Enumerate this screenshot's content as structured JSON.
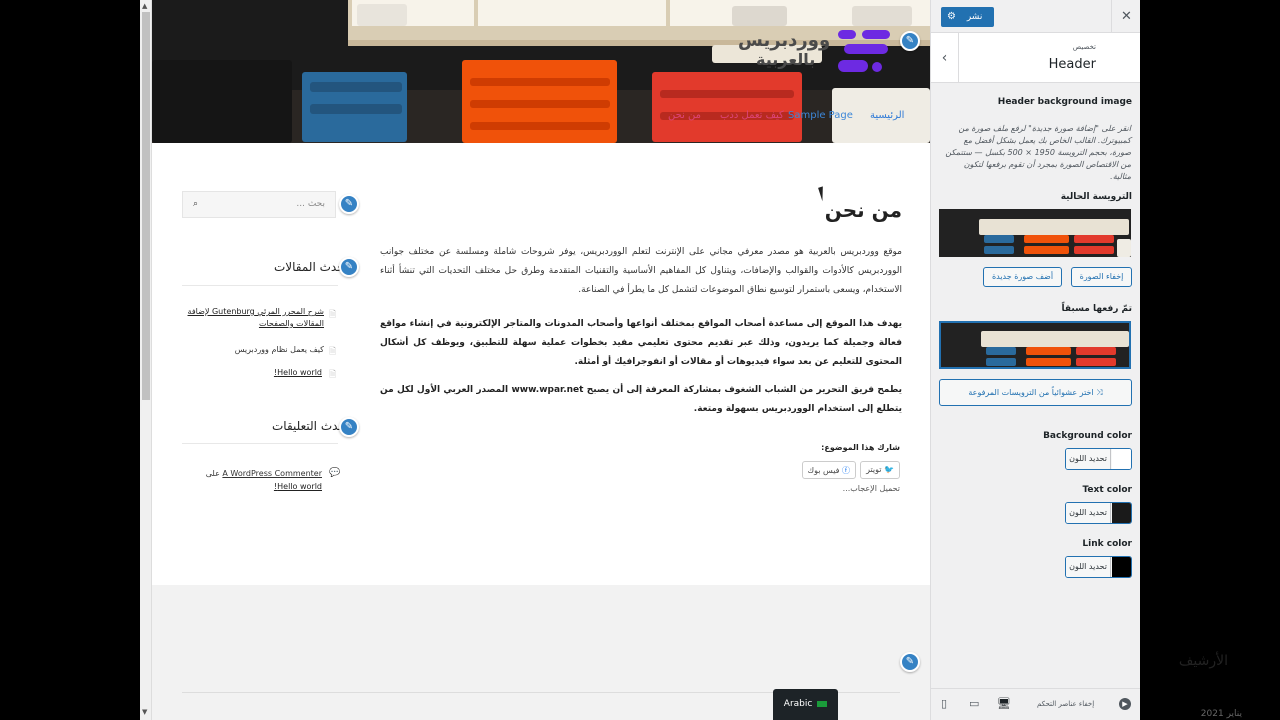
{
  "site": {
    "logo_text_line1": "ووردبريس",
    "logo_text_line2": "بالعربية",
    "nav": [
      "الرئيسية",
      "Sample Page",
      "كيف تعمل ددب",
      "من نحن"
    ]
  },
  "article": {
    "title": "من نحن",
    "paragraph1": "موقع ووردبريس بالعربية هو مصدر معرفي مجاني على الإنترنت لتعلم الووردبريس، يوفر شروحات شاملة ومسلسة عن مختلف جوانب الووردبريس كالأدوات والقوالب والإضافات، ويتناول كل المفاهيم الأساسية والتقنيات المتقدمة وطرق حل مختلف التحديات التي تنشأ أثناء الاستخدام، ويسعى باستمرار لتوسيع نطاق الموضوعات لتشمل كل ما يطرأ في الصناعة.",
    "paragraph2": "يهدف هذا الموقع إلى مساعدة أصحاب المواقع بمختلف أنواعها وأصحاب المدونات والمتاجر الإلكترونية في إنشاء مواقع فعالة وجميلة كما يريدون، وذلك عبر تقديم محتوى تعليمي مفيد بخطوات عملية سهلة للتطبيق، ويوظف كل أشكال المحتوى للتعليم عن بعد سواء فيديوهات أو مقالات أو انفوجرافيك أو أمثلة.",
    "paragraph3": "يطمح فريق التحرير من الشباب الشغوف بمشاركة المعرفة إلى أن يصبح www.wpar.net المصدر العربي الأول لكل من يتطلع إلى استخدام الووردبريس بسهولة ومتعة.",
    "share_label": "شارك هذا الموضوع:",
    "share_buttons": [
      "تويتر",
      "فيس بوك"
    ],
    "like_label": "تحميل الإعجاب..."
  },
  "sidebar": {
    "search_placeholder": "بحث ...",
    "recent_posts_title": "أحدث المقالات",
    "recent_posts": [
      "شرح المحرر المرئي Gutenburg لإضافة المقالات والصفحات",
      "كيف يعمل نظام ووردبريس",
      "Hello world!"
    ],
    "recent_comments_title": "أحدث التعليقات",
    "recent_comment_author": "A WordPress Commenter",
    "recent_comment_on": "على",
    "recent_comment_post": "Hello world!"
  },
  "archive": {
    "title": "الأرشيف",
    "date": "يناير 2021"
  },
  "language_switcher": {
    "label": "Arabic"
  },
  "customizer": {
    "publish_label": "نشر",
    "close_icon": "close-icon",
    "section_subtitle": "تخصيص",
    "section_title": "Header",
    "header_bg_label": "Header background image",
    "header_bg_desc": "انقر على \"إضافة صورة جديدة\" لرفع ملف صورة من كمبيوترك. القالب الخاص بك يعمل بشكل أفضل مع صورة، بحجم الترويسة 1950 × 500 بكسل — ستتمكن من الاقتصاص الصورة بمجرد أن تقوم برفعها لتكون مثالية.",
    "current_header_label": "الترويسة الحالية",
    "hide_image_button": "إخفاء الصورة",
    "add_image_button": "أضف صورة جديدة",
    "previously_uploaded_label": "تمّ رفعها مسبقاً",
    "randomize_button": "اختر عشوائياً من الترويسات المرفوعة",
    "background_color_label": "Background color",
    "text_color_label": "Text color",
    "link_color_label": "Link color",
    "select_color": "تحديد اللون",
    "colors": {
      "background": "#ffffff",
      "text": "#1a1a1a",
      "link": "#000000",
      "accent": "#2271b1",
      "logo": "#6d2ae2"
    },
    "collapse_label": "إخفاء عناصر التحكم"
  }
}
